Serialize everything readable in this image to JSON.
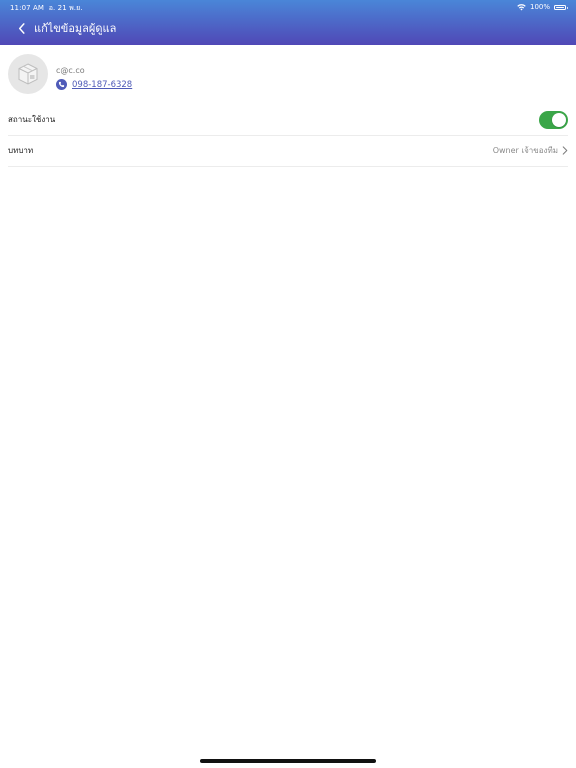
{
  "status_bar": {
    "time": "11:07 AM",
    "date": "อ. 21 พ.ย.",
    "battery": "100%",
    "wifi_icon": "wifi-icon",
    "battery_icon": "battery-icon"
  },
  "header": {
    "back_icon": "chevron-left-icon",
    "title": "แก้ไขข้อมูลผู้ดูแล",
    "gradient": [
      "#4a86d8",
      "#5048b6"
    ]
  },
  "profile": {
    "avatar_icon": "cube-placeholder-icon",
    "email": "c@c.co",
    "phone_icon": "phone-icon",
    "phone": "098-187-6328"
  },
  "settings": {
    "status": {
      "label": "สถานะใช้งาน",
      "enabled": true,
      "toggle_color": "#3aa648"
    },
    "role": {
      "label": "บทบาท",
      "value": "Owner เจ้าของทีม",
      "chevron_icon": "chevron-right-icon"
    }
  }
}
